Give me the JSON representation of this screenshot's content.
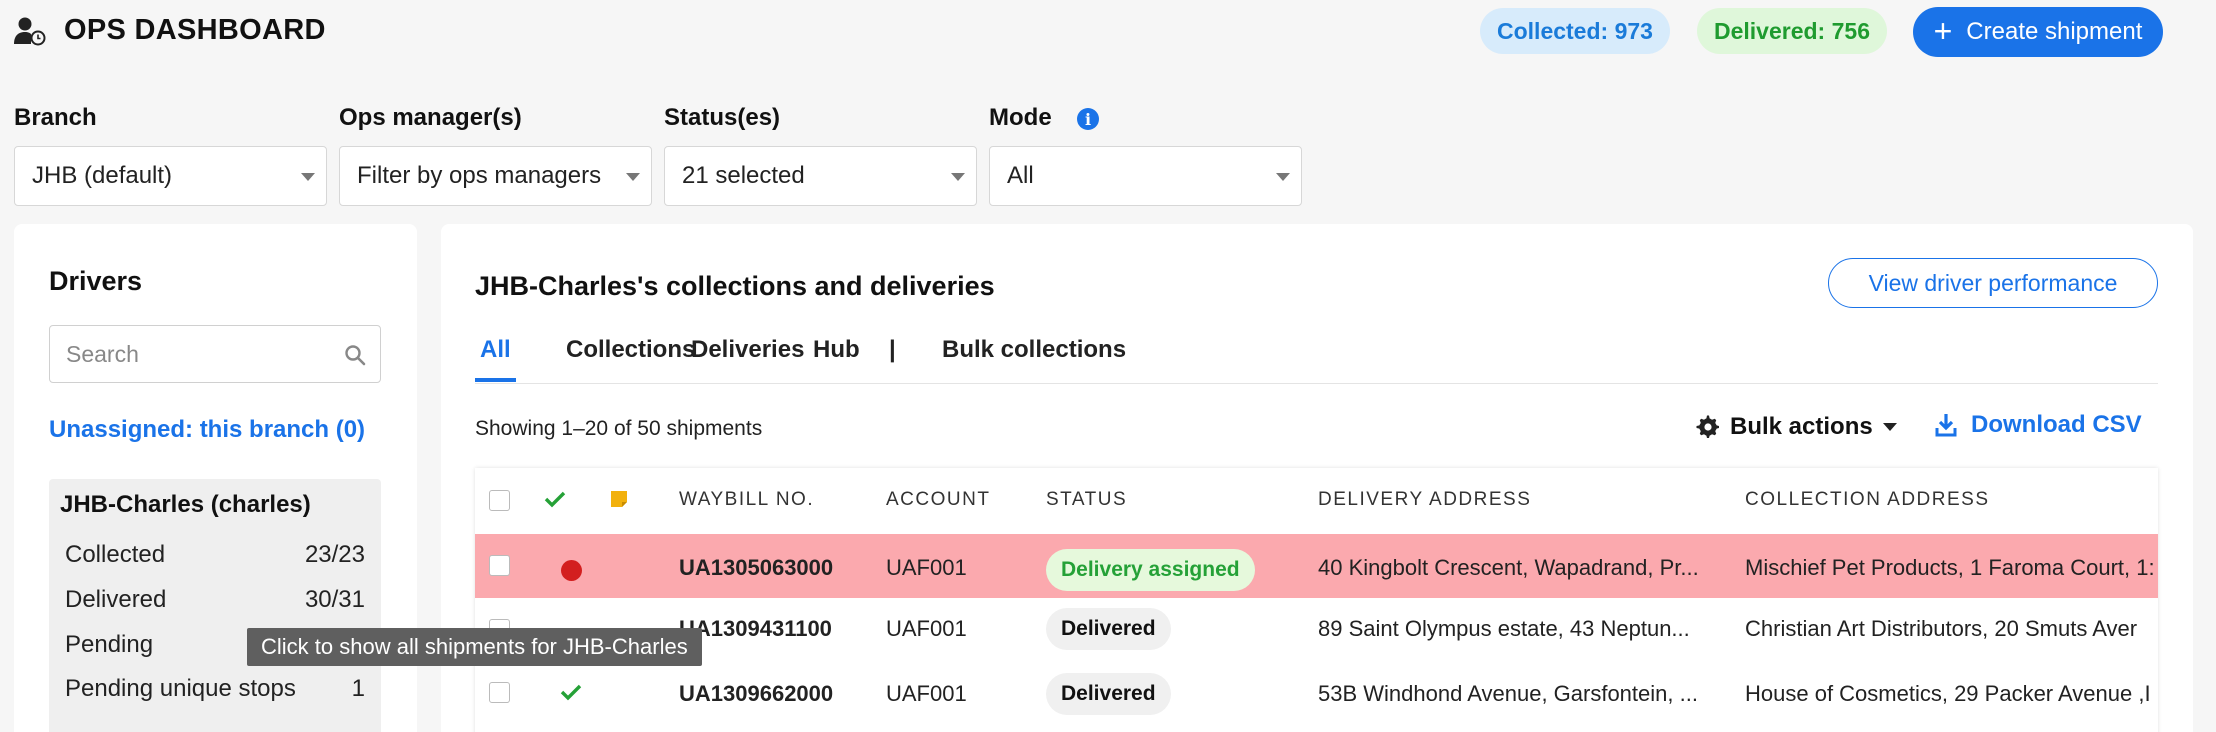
{
  "header": {
    "title": "OPS DASHBOARD",
    "collected_label": "Collected: 973",
    "delivered_label": "Delivered: 756",
    "create_button": "Create shipment"
  },
  "filters": {
    "branch": {
      "label": "Branch",
      "value": "JHB (default)"
    },
    "ops_managers": {
      "label": "Ops manager(s)",
      "value": "Filter by ops managers"
    },
    "statuses": {
      "label": "Status(es)",
      "value": "21 selected"
    },
    "mode": {
      "label": "Mode",
      "value": "All"
    }
  },
  "drivers": {
    "title": "Drivers",
    "search_placeholder": "Search",
    "unassigned": "Unassigned: this branch (0)",
    "card": {
      "name": "JHB-Charles (charles)",
      "rows": [
        {
          "label": "Collected",
          "value": "23/23"
        },
        {
          "label": "Delivered",
          "value": "30/31"
        },
        {
          "label": "Pending",
          "value": ""
        },
        {
          "label": "Pending unique stops",
          "value": "1"
        }
      ]
    }
  },
  "main": {
    "title": "JHB-Charles's collections and deliveries",
    "view_performance": "View driver performance",
    "tabs": [
      "All",
      "Collections",
      "Deliveries",
      "Hub",
      "|",
      "Bulk collections"
    ],
    "showing": "Showing 1–20 of 50 shipments",
    "bulk_actions": "Bulk actions",
    "download_csv": "Download CSV",
    "columns": [
      "WAYBILL NO.",
      "ACCOUNT",
      "STATUS",
      "DELIVERY ADDRESS",
      "COLLECTION ADDRESS"
    ],
    "rows": [
      {
        "waybill": "UA1305063000",
        "account": "UAF001",
        "status": "Delivery assigned",
        "delivery": "40 Kingbolt Crescent, Wapadrand, Pr...",
        "collection": "Mischief Pet Products, 1 Faroma Court, 1:"
      },
      {
        "waybill": "UA1309431100",
        "account": "UAF001",
        "status": "Delivered",
        "delivery": "89 Saint Olympus estate, 43 Neptun...",
        "collection": "Christian Art Distributors, 20 Smuts Aver"
      },
      {
        "waybill": "UA1309662000",
        "account": "UAF001",
        "status": "Delivered",
        "delivery": "53B Windhond Avenue, Garsfontein, ...",
        "collection": "House of Cosmetics, 29 Packer Avenue ,I"
      }
    ]
  },
  "tooltip": "Click to show all shipments for JHB-Charles",
  "colors": {
    "accent": "#1a73e8",
    "alert_row": "#fba9ae",
    "success": "#25a137",
    "danger": "#d31f1f"
  }
}
